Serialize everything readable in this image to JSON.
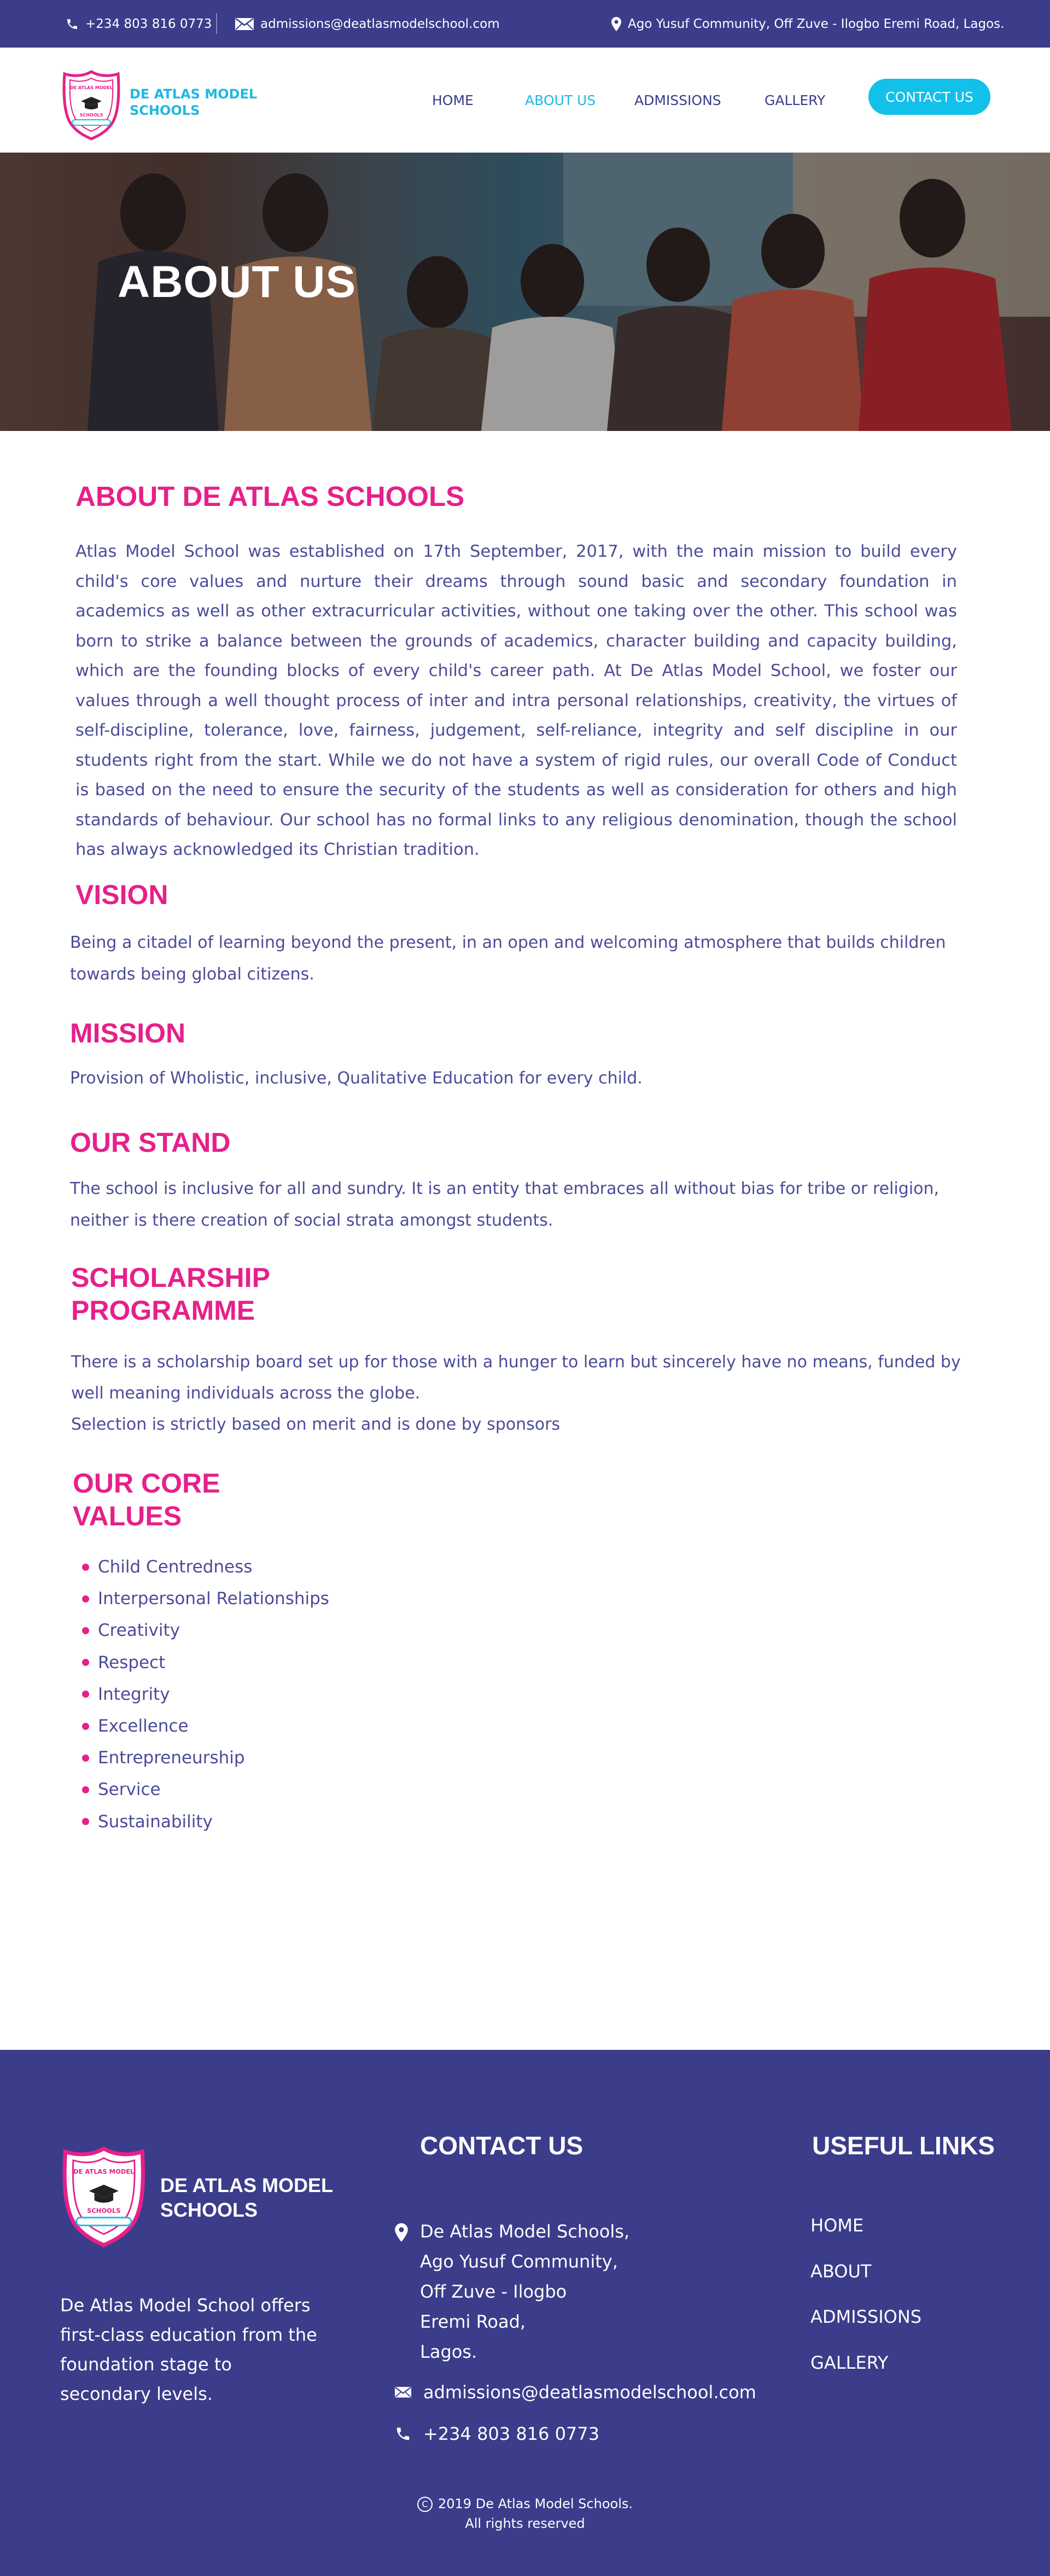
{
  "topbar": {
    "phone": "+234 803 816 0773",
    "email": "admissions@deatlasmodelschool.com",
    "address": "Ago Yusuf Community, Off Zuve - Ilogbo Eremi Road, Lagos."
  },
  "header": {
    "brand_line1": "DE ATLAS MODEL",
    "brand_line2": "SCHOOLS",
    "nav": [
      "HOME",
      "ABOUT US",
      "ADMISSIONS",
      "GALLERY"
    ],
    "active_nav": "ABOUT US",
    "contact_button": "CONTACT US"
  },
  "hero": {
    "title": "ABOUT US"
  },
  "about": {
    "title": "ABOUT DE ATLAS SCHOOLS",
    "text": "Atlas Model School was established on 17th September, 2017, with the main mission to build every child's core values and nurture their dreams through sound basic and secondary foundation in academics as well as other extracurricular activities, without one taking over the other. This school was born to strike a balance between the grounds of academics, character building and capacity building, which are the founding blocks of every child's career path. At De Atlas Model School, we foster our values through a well thought process of inter and intra personal relationships, creativity, the virtues of self-discipline, tolerance, love, fairness, judgement, self-reliance, integrity and self discipline in our students right from the start. While we do not have a system of rigid rules, our overall Code of Conduct is based on the need to ensure the security of the students as well as consideration for others and high standards of behaviour. Our school has no formal links to any religious denomination, though the school has always acknowledged its Christian tradition."
  },
  "vision": {
    "title": "VISION",
    "text": "Being a citadel of learning beyond the present, in an open and welcoming atmosphere that builds children towards being global citizens."
  },
  "mission": {
    "title": "MISSION",
    "text": "Provision of Wholistic, inclusive, Qualitative Education for every child."
  },
  "stand": {
    "title": "OUR STAND",
    "text": "The school is inclusive for all and sundry. It is an entity that embraces all without bias for tribe or religion, neither is there creation of social strata amongst students."
  },
  "scholarship": {
    "title_line1": "SCHOLARSHIP",
    "title_line2": "PROGRAMME",
    "text": "There is a scholarship board set up for those with a hunger to learn but sincerely have no means, funded by well meaning individuals across the globe.",
    "text2": "Selection is strictly based on merit and is done by sponsors"
  },
  "core_values": {
    "title_line1": "OUR CORE",
    "title_line2": "VALUES",
    "items": [
      "Child Centredness",
      "Interpersonal Relationships",
      "Creativity",
      "Respect",
      "Integrity",
      "Excellence",
      "Entrepreneurship",
      "Service",
      "Sustainability"
    ]
  },
  "footer": {
    "brand_line1": "DE ATLAS MODEL",
    "brand_line2": "SCHOOLS",
    "about": "De Atlas Model School offers first-class education from the foundation stage to secondary levels.",
    "contact_title": "CONTACT US",
    "address_lines": [
      "De Atlas Model Schools,",
      "Ago Yusuf Community,",
      "Off Zuve - Ilogbo",
      "Eremi Road,",
      "Lagos."
    ],
    "email": "admissions@deatlasmodelschool.com",
    "phone": "+234 803 816 0773",
    "links_title": "USEFUL LINKS",
    "links": [
      "HOME",
      "ABOUT",
      "ADMISSIONS",
      "GALLERY"
    ],
    "copyright_line1": "2019 De Atlas Model Schools.",
    "copyright_line2": "All rights reserved"
  },
  "colors": {
    "primary": "#3b3c8a",
    "accent_pink": "#e6208a",
    "accent_cyan": "#12c0ea"
  }
}
